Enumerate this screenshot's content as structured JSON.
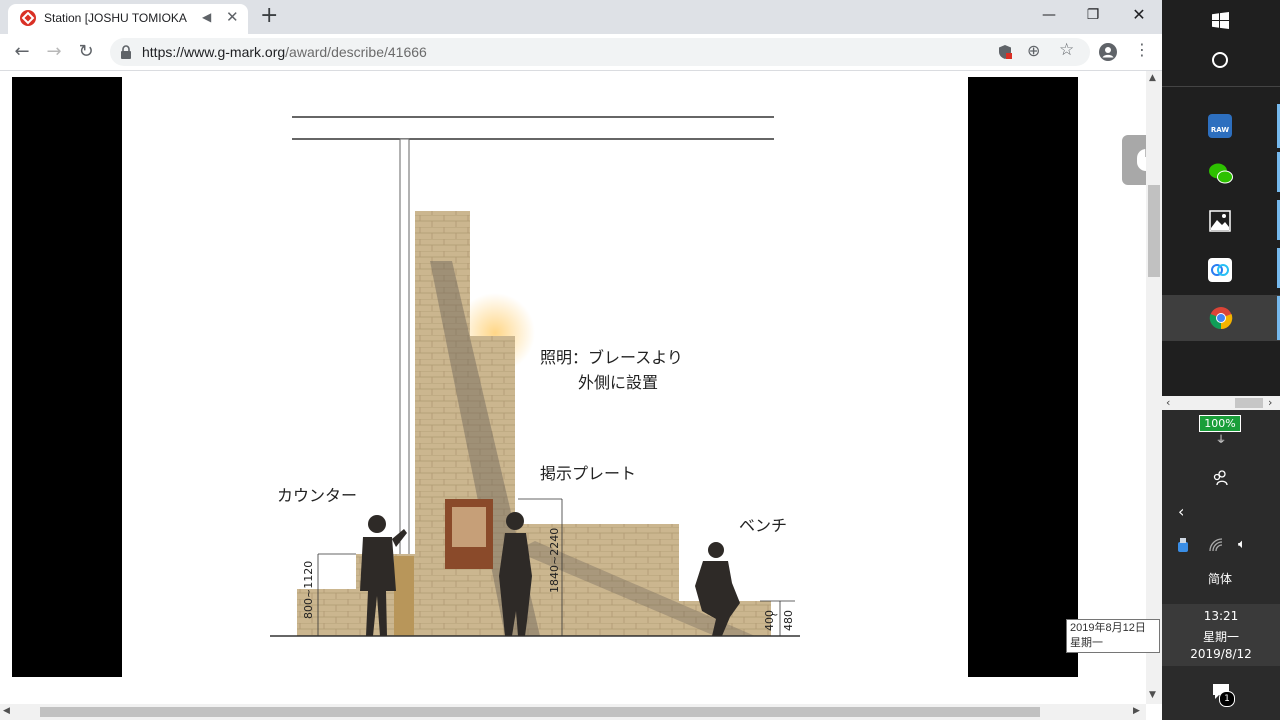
{
  "browser": {
    "tab_title": "Station [JOSHU TOMIOKA",
    "url_host": "https://www.g-mark.org",
    "url_path": "/award/describe/41666",
    "new_tab_label": "+"
  },
  "drawing": {
    "label_lighting_line1": "照明：ブレースより",
    "label_lighting_line2": "外側に設置",
    "label_signboard": "掲示プレート",
    "label_counter": "カウンター",
    "label_bench": "ベンチ",
    "dim_counter": "800~1120",
    "dim_sign": "1840~2240",
    "dim_bench_top": "400",
    "dim_bench_mid": "~",
    "dim_bench_bottom": "480"
  },
  "taskbar": {
    "battery": "100%",
    "ime": "简体",
    "time": "13:21",
    "weekday": "星期一",
    "date": "2019/8/12",
    "notification_count": "1"
  },
  "tooltip": {
    "line1": "2019年8月12日",
    "line2": "星期一"
  },
  "colors": {
    "brick": "#c9b48c",
    "chrome_accent": "#d93025"
  }
}
